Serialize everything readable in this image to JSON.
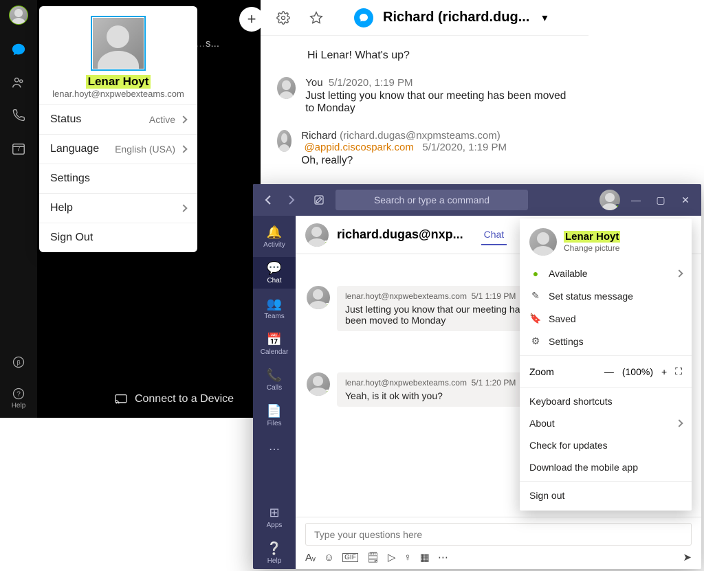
{
  "webex": {
    "header": {
      "title": "Richard (richard.dug...",
      "plus": "+"
    },
    "people_truncated": "s...",
    "sidebar": {
      "calendar_day": "7",
      "help_label": "Help"
    },
    "greeting": "Hi Lenar! What's up?",
    "messages": [
      {
        "sender": "You",
        "timestamp": "5/1/2020, 1:19 PM",
        "text": "Just letting you know that our meeting has been moved to Monday"
      },
      {
        "sender": "Richard",
        "email": "(richard.dugas@nxpmsteams.com)",
        "mention": "@appid.ciscospark.com",
        "timestamp": "5/1/2020, 1:19 PM",
        "text": "Oh, really?"
      }
    ],
    "profile": {
      "name": "Lenar Hoyt",
      "email": "lenar.hoyt@nxpwebexteams.com",
      "rows": {
        "status_label": "Status",
        "status_value": "Active",
        "language_label": "Language",
        "language_value": "English (USA)",
        "settings": "Settings",
        "help": "Help",
        "signout": "Sign Out"
      }
    },
    "connect": "Connect to a Device"
  },
  "teams": {
    "search_placeholder": "Search or type a command",
    "rail": {
      "activity": "Activity",
      "chat": "Chat",
      "teams": "Teams",
      "calendar": "Calendar",
      "calls": "Calls",
      "files": "Files",
      "apps": "Apps",
      "help": "Help"
    },
    "header": {
      "title": "richard.dugas@nxp...",
      "tab": "Chat"
    },
    "messages": [
      {
        "email": "lenar.hoyt@nxpwebexteams.com",
        "timestamp": "5/1 1:19 PM",
        "text": "Just letting you know that our meeting has been moved to Monday"
      },
      {
        "email": "lenar.hoyt@nxpwebexteams.com",
        "timestamp": "5/1 1:20 PM",
        "text": "Yeah, is it ok with you?"
      }
    ],
    "composer": {
      "placeholder": "Type your questions here"
    },
    "profile_menu": {
      "name": "Lenar Hoyt",
      "change_picture": "Change picture",
      "available": "Available",
      "set_status": "Set status message",
      "saved": "Saved",
      "settings": "Settings",
      "zoom_label": "Zoom",
      "zoom_value": "(100%)",
      "keyboard": "Keyboard shortcuts",
      "about": "About",
      "check_updates": "Check for updates",
      "download_app": "Download the mobile app",
      "signout": "Sign out"
    }
  }
}
